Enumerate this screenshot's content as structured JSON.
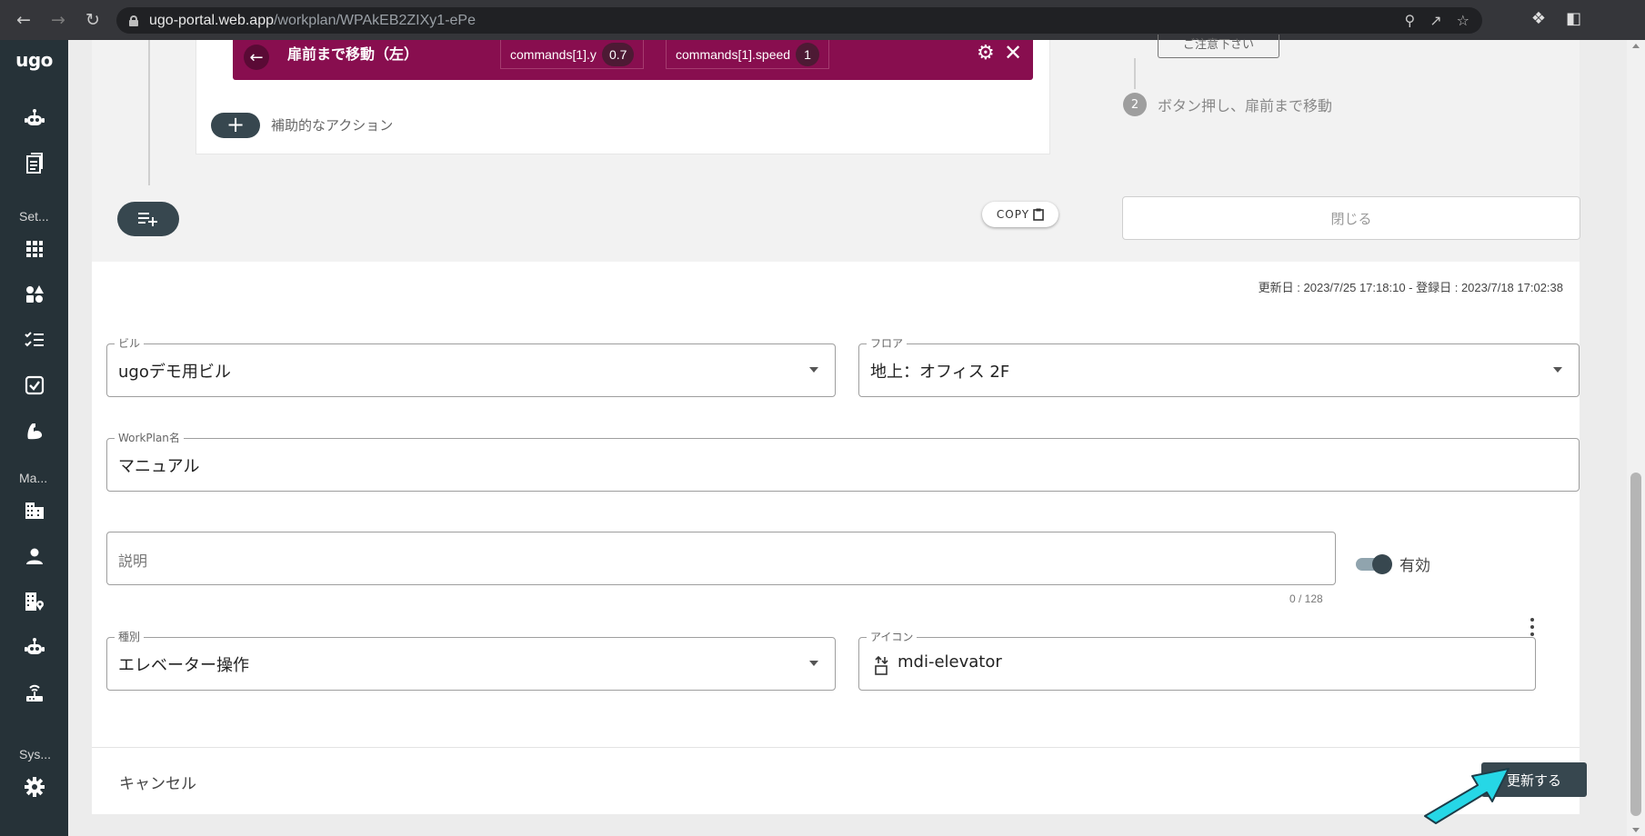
{
  "browser": {
    "url_host": "ugo-portal.web.app",
    "url_path": "/workplan/WPAkEB2ZIXy1-ePe"
  },
  "sidebar": {
    "logo": "ugo",
    "section_settings": "Set...",
    "section_manage": "Ma...",
    "section_system": "Sys..."
  },
  "action": {
    "title": "扉前まで移動（左）",
    "param1_name": "commands[1].y",
    "param1_value": "0.7",
    "param2_name": "commands[1].speed",
    "param2_value": "1",
    "sub_action_label": "補助的なアクション",
    "copy_label": "COPY"
  },
  "steps": {
    "partial_button": "ご注意下さい",
    "step2_num": "2",
    "step2_text": "ボタン押し、扉前まで移動",
    "close_label": "閉じる"
  },
  "meta": {
    "dates": "更新日 : 2023/7/25 17:18:10 - 登録日 : 2023/7/18 17:02:38"
  },
  "form": {
    "building_label": "ビル",
    "building_value": "ugoデモ用ビル",
    "floor_label": "フロア",
    "floor_value": "地上：オフィス 2F",
    "name_label": "WorkPlan名",
    "name_value": "マニュアル",
    "description_placeholder": "説明",
    "description_counter": "0 / 128",
    "enabled_label": "有効",
    "type_label": "種別",
    "type_value": "エレベーター操作",
    "icon_label": "アイコン",
    "icon_value": "mdi-elevator"
  },
  "footer": {
    "cancel_label": "キャンセル",
    "update_label": "更新する"
  }
}
